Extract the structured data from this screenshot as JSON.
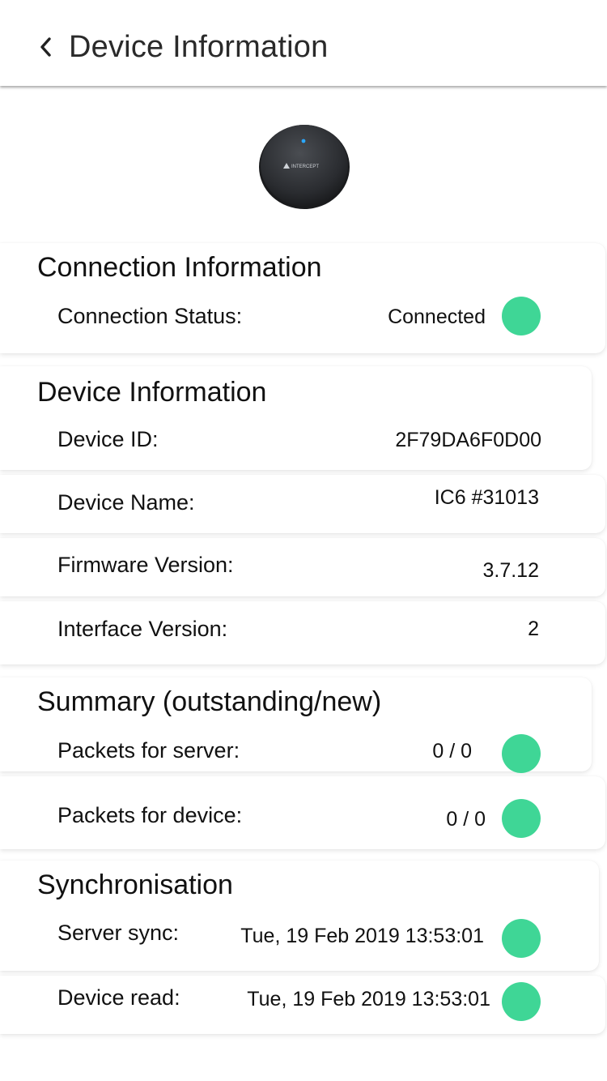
{
  "header": {
    "title": "Device Information",
    "back_icon": "chevron-left-icon"
  },
  "device_image": {
    "logo_text": "INTERCEPT",
    "led_color": "#2aa8ff"
  },
  "status_color": "#3fd696",
  "connection": {
    "title": "Connection Information",
    "status_label": "Connection Status:",
    "status_value": "Connected"
  },
  "device_info": {
    "title": "Device Information",
    "rows": [
      {
        "label": "Device ID:",
        "value": "2F79DA6F0D00"
      },
      {
        "label": "Device Name:",
        "value": "IC6 #31013"
      },
      {
        "label": "Firmware Version:",
        "value": "3.7.12"
      },
      {
        "label": "Interface Version:",
        "value": "2"
      }
    ]
  },
  "summary": {
    "title": "Summary (outstanding/new)",
    "rows": [
      {
        "label": "Packets for server:",
        "value": "0 / 0"
      },
      {
        "label": "Packets for device:",
        "value": "0 / 0"
      }
    ]
  },
  "sync": {
    "title": "Synchronisation",
    "rows": [
      {
        "label": "Server sync:",
        "value": "Tue, 19 Feb 2019 13:53:01"
      },
      {
        "label": "Device read:",
        "value": "Tue, 19 Feb 2019 13:53:01"
      }
    ]
  }
}
